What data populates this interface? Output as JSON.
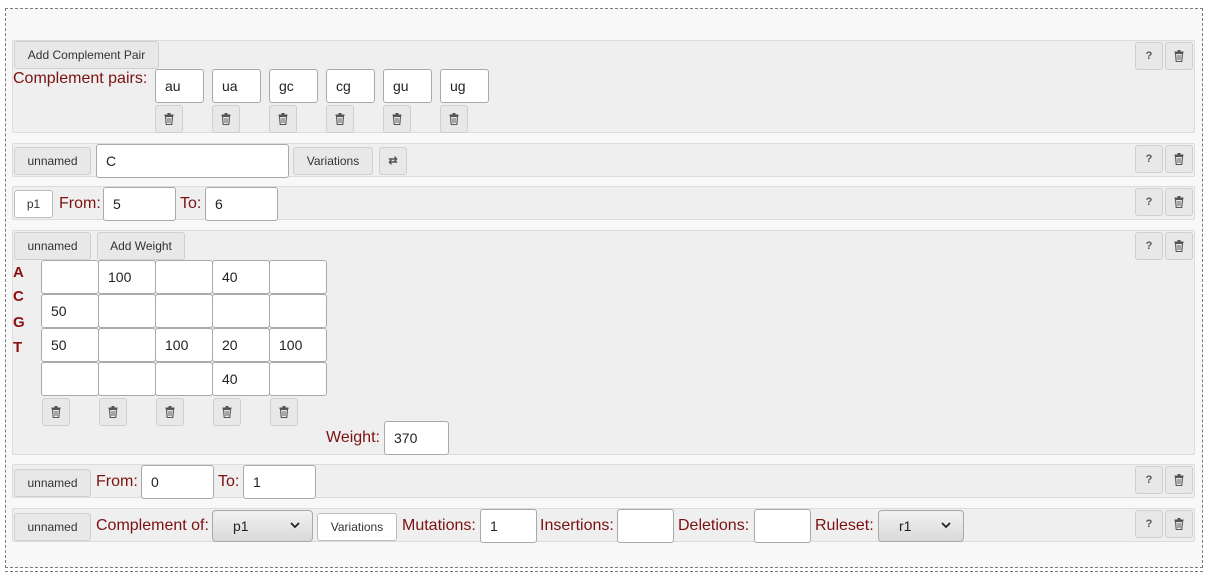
{
  "complement_panel": {
    "add_button": "Add Complement Pair",
    "label": "Complement pairs:",
    "pairs": [
      "au",
      "ua",
      "gc",
      "cg",
      "gu",
      "ug"
    ]
  },
  "sequence_panel": {
    "name_button": "unnamed",
    "sequence_value": "C",
    "variations_button": "Variations",
    "swap_icon": "⇄"
  },
  "position_panel": {
    "name_field": "p1",
    "from_label": "From:",
    "from_value": "5",
    "to_label": "To:",
    "to_value": "6"
  },
  "weight_panel": {
    "name_button": "unnamed",
    "add_button": "Add Weight",
    "bases": [
      "A",
      "C",
      "G",
      "T"
    ],
    "matrix": [
      [
        "",
        "100",
        "",
        "40",
        ""
      ],
      [
        "50",
        "",
        "",
        "",
        ""
      ],
      [
        "50",
        "",
        "100",
        "20",
        "100"
      ],
      [
        "",
        "",
        "",
        "40",
        ""
      ]
    ],
    "weight_label": "Weight:",
    "weight_value": "370"
  },
  "range_panel": {
    "name_button": "unnamed",
    "from_label": "From:",
    "from_value": "0",
    "to_label": "To:",
    "to_value": "1"
  },
  "complement_of_panel": {
    "name_button": "unnamed",
    "complement_label": "Complement of:",
    "complement_value": "p1",
    "variations_button": "Variations",
    "mutations_label": "Mutations:",
    "mutations_value": "1",
    "insertions_label": "Insertions:",
    "insertions_value": "",
    "deletions_label": "Deletions:",
    "deletions_value": "",
    "ruleset_label": "Ruleset:",
    "ruleset_value": "r1"
  },
  "common": {
    "help_icon": "?"
  },
  "icons": {
    "help": "question-icon",
    "delete": "trash-icon",
    "swap": "swap-icon",
    "dropdown": "chevron-down-icon"
  }
}
